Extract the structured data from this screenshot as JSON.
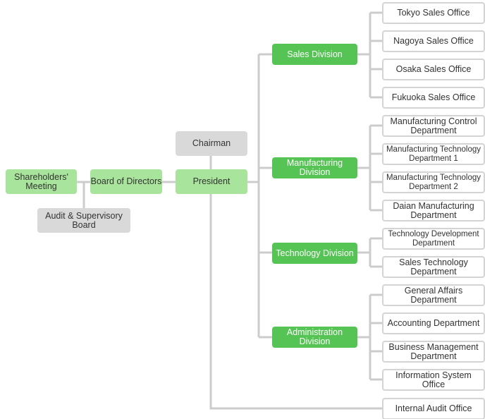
{
  "top": {
    "shareholders": "Shareholders' Meeting",
    "board": "Board of Directors",
    "president": "President",
    "chairman": "Chairman",
    "audit": "Audit & Supervisory Board"
  },
  "divisions": [
    {
      "label": "Sales Division",
      "units": [
        "Tokyo Sales Office",
        "Nagoya Sales Office",
        "Osaka Sales Office",
        "Fukuoka Sales Office"
      ]
    },
    {
      "label": "Manufacturing Division",
      "units": [
        "Manufacturing Control Department",
        "Manufacturing Technology Department 1",
        "Manufacturing Technology Department 2",
        "Daian Manufacturing Department"
      ]
    },
    {
      "label": "Technology Division",
      "units": [
        "Technology Development Department",
        "Sales Technology Department"
      ]
    },
    {
      "label": "Administration Division",
      "units": [
        "General Affairs Department",
        "Accounting Department",
        "Business Management Department",
        "Information System Office"
      ]
    }
  ],
  "internal_audit": "Internal Audit Office",
  "colors": {
    "light_green": "#a8e49b",
    "green": "#55c454",
    "gray": "#d9d9d9",
    "line": "#cccccc"
  }
}
